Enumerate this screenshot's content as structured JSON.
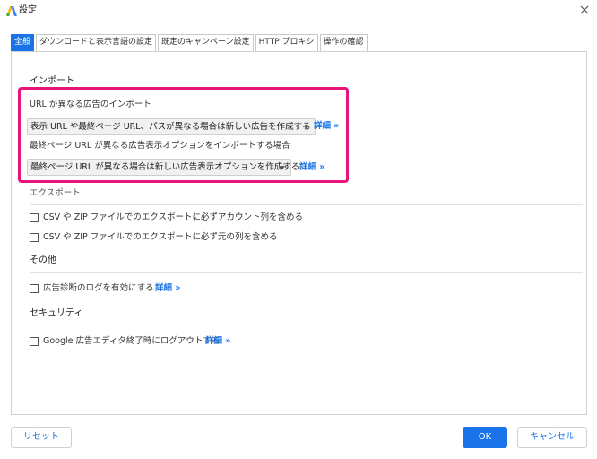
{
  "window": {
    "title": "設定",
    "close_icon": "close-icon",
    "logo_icon": "google-ads-logo-icon"
  },
  "tabs": [
    {
      "label": "全般",
      "active": true
    },
    {
      "label": "ダウンロードと表示言語の設定",
      "active": false
    },
    {
      "label": "既定のキャンペーン設定",
      "active": false
    },
    {
      "label": "HTTP プロキシ",
      "active": false
    },
    {
      "label": "操作の確認",
      "active": false
    }
  ],
  "import": {
    "title": "インポート",
    "url_label": "URL が異なる広告のインポート",
    "url_select": "表示 URL や最終ページ URL、パスが異なる場合は新しい広告を作成する",
    "url_link": "詳細 »",
    "option_label": "最終ページ URL が異なる広告表示オプションをインポートする場合",
    "option_select": "最終ページ URL が異なる場合は新しい広告表示オプションを作成する",
    "option_link": "詳細 »"
  },
  "export": {
    "title": "エクスポート",
    "checkbox1": "CSV や ZIP ファイルでのエクスポートに必ずアカウント列を含める",
    "checkbox2": "CSV や ZIP ファイルでのエクスポートに必ず元の列を含める"
  },
  "other": {
    "title": "その他",
    "checkbox": "広告診断のログを有効にする",
    "link": "詳細 »"
  },
  "security": {
    "title": "セキュリティ",
    "checkbox": "Google 広告エディタ終了時にログアウトする",
    "link": "詳細 »"
  },
  "footer": {
    "reset": "リセット",
    "ok": "OK",
    "cancel": "キャンセル"
  },
  "colors": {
    "accent": "#1a73e8",
    "highlight": "#e5157b"
  }
}
